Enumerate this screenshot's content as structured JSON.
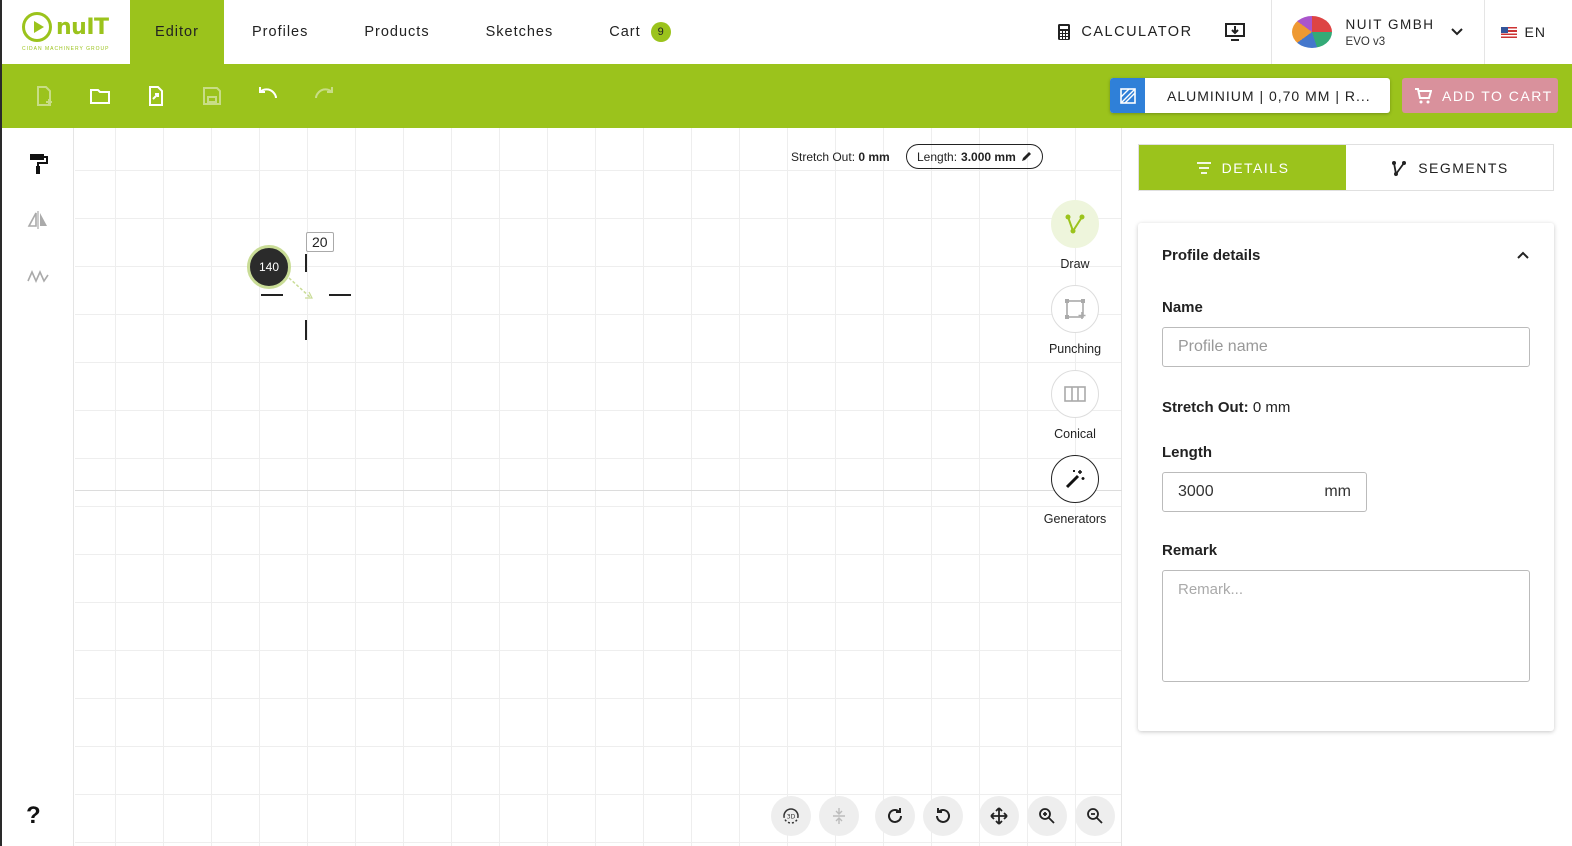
{
  "nav": {
    "logo_text": "nuIT",
    "logo_sub": "CIDAN MACHINERY GROUP",
    "tabs": [
      {
        "label": "Editor"
      },
      {
        "label": "Profiles"
      },
      {
        "label": "Products"
      },
      {
        "label": "Sketches"
      },
      {
        "label": "Cart"
      }
    ],
    "cart_count": "9",
    "calculator_label": "CALCULATOR",
    "company_name": "NUIT GMBH",
    "company_sub": "EVO v3",
    "language": "EN"
  },
  "toolbar": {
    "icons": [
      "new-file-icon",
      "open-folder-icon",
      "export-file-icon",
      "save-icon",
      "undo-icon",
      "redo-icon"
    ],
    "material_label": "ALUMINIUM | 0,70 MM | R...",
    "add_to_cart_label": "ADD TO CART"
  },
  "canvas": {
    "stretch_label": "Stretch Out:",
    "stretch_value": "0 mm",
    "length_label": "Length:",
    "length_value": "3.000 mm",
    "angle_value": "140",
    "segment_value": "20",
    "tools": [
      {
        "label": "Draw"
      },
      {
        "label": "Punching"
      },
      {
        "label": "Conical"
      },
      {
        "label": "Generators"
      }
    ],
    "bottom_controls": [
      "3d-view-icon",
      "align-icon",
      "rotate-cw-icon",
      "rotate-ccw-icon",
      "move-icon",
      "zoom-in-icon",
      "zoom-out-icon"
    ]
  },
  "rail": {
    "help_label": "?"
  },
  "panel": {
    "tabs": [
      {
        "label": "DETAILS"
      },
      {
        "label": "SEGMENTS"
      }
    ],
    "card_title": "Profile details",
    "name_label": "Name",
    "name_placeholder": "Profile name",
    "stretch_label": "Stretch Out:",
    "stretch_value": "0 mm",
    "length_label": "Length",
    "length_value": "3000",
    "length_unit": "mm",
    "remark_label": "Remark",
    "remark_placeholder": "Remark..."
  },
  "colors": {
    "accent": "#9bc31c",
    "material_blue": "#2f80d8",
    "add_cart_pink": "#d9919c"
  }
}
